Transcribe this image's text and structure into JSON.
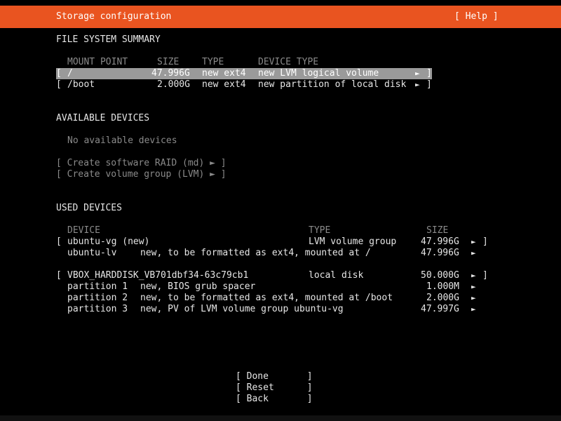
{
  "header": {
    "title": "Storage configuration",
    "help_label": "[ Help ]"
  },
  "file_system_summary": {
    "heading": "FILE SYSTEM SUMMARY",
    "columns": {
      "mount_point": "MOUNT POINT",
      "size": "SIZE",
      "type": "TYPE",
      "device_type": "DEVICE TYPE"
    },
    "rows": [
      {
        "open": "[",
        "mount": "/",
        "size": "47.996G",
        "type": "new ext4",
        "device_type": "new LVM logical volume",
        "arrow": "►",
        "close": "]"
      },
      {
        "open": "[",
        "mount": "/boot",
        "size": "2.000G",
        "type": "new ext4",
        "device_type": "new partition of local disk",
        "arrow": "►",
        "close": "]"
      }
    ]
  },
  "available_devices": {
    "heading": "AVAILABLE DEVICES",
    "empty_text": "No available devices",
    "actions": [
      "[ Create software RAID (md) ► ]",
      "[ Create volume group (LVM) ► ]"
    ]
  },
  "used_devices": {
    "heading": "USED DEVICES",
    "columns": {
      "device": "DEVICE",
      "type": "TYPE",
      "size": "SIZE"
    },
    "vg": {
      "open": "[",
      "name": "ubuntu-vg (new)",
      "type": "LVM volume group",
      "size": "47.996G",
      "arrow": "►",
      "close": "]",
      "children": [
        {
          "name": "ubuntu-lv",
          "desc": "new, to be formatted as ext4, mounted at /",
          "size": "47.996G",
          "arrow": "►"
        }
      ]
    },
    "disk": {
      "open": "[",
      "name": "VBOX_HARDDISK_VB701dbf34-63c79cb1",
      "type": "local disk",
      "size": "50.000G",
      "arrow": "►",
      "close": "]",
      "partitions": [
        {
          "name": "partition 1",
          "desc": "new, BIOS grub spacer",
          "size": "1.000M",
          "arrow": "►"
        },
        {
          "name": "partition 2",
          "desc": "new, to be formatted as ext4, mounted at /boot",
          "size": "2.000G",
          "arrow": "►"
        },
        {
          "name": "partition 3",
          "desc": "new, PV of LVM volume group ubuntu-vg",
          "size": "47.997G",
          "arrow": "►"
        }
      ]
    }
  },
  "buttons": {
    "done": "[ Done       ]",
    "reset": "[ Reset      ]",
    "back": "[ Back       ]"
  },
  "colors": {
    "accent": "#e95420",
    "selection": "#9a9a9a",
    "background": "#000000",
    "text": "#e6e6e6",
    "dim_text": "#8a8a8a"
  }
}
